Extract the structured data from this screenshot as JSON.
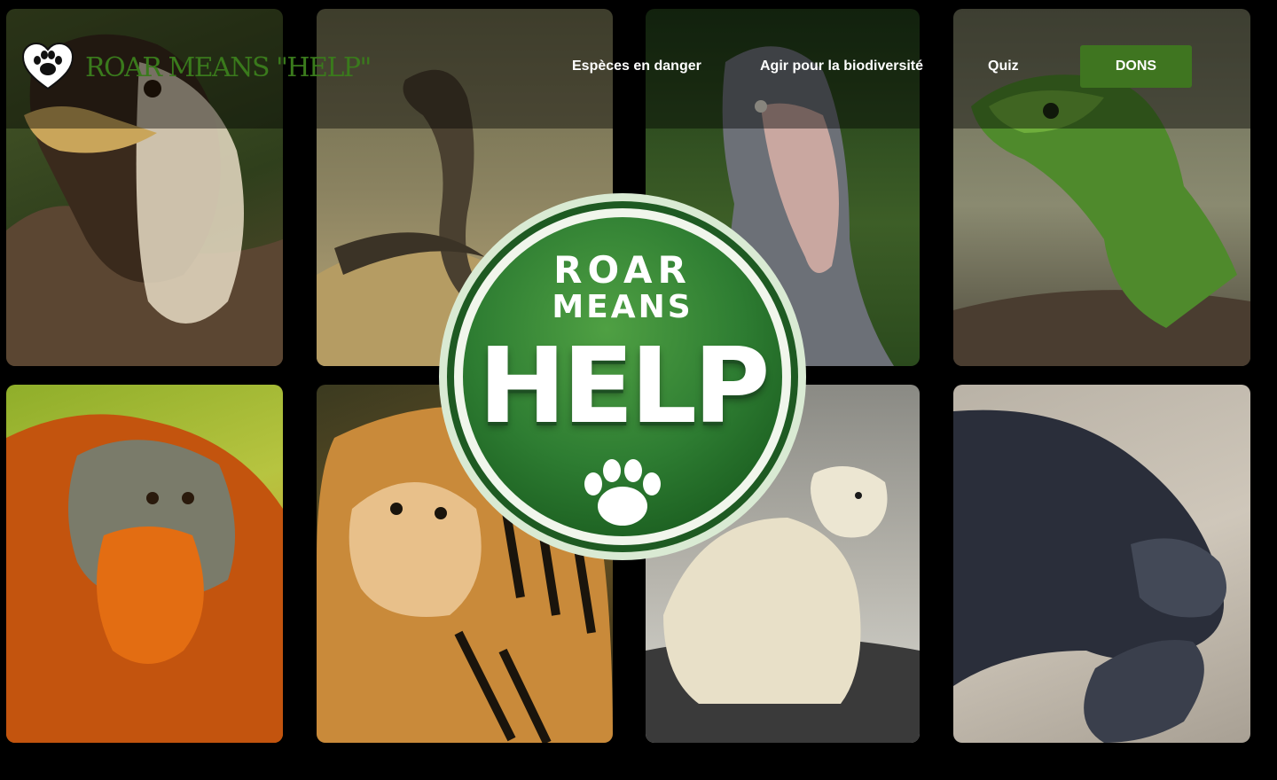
{
  "brand": {
    "name": "ROAR MEANS \"HELP\"",
    "logo_icon": "paw-heart-icon",
    "color": "#3a7a1c"
  },
  "nav": {
    "items": [
      {
        "label": "Espèces en danger"
      },
      {
        "label": "Agir pour la biodiversité"
      },
      {
        "label": "Quiz"
      }
    ],
    "donate_label": "DONS",
    "donate_color": "#3f7520"
  },
  "badge": {
    "line1": "ROAR",
    "line2": "MEANS",
    "line3": "HELP",
    "icon": "paw-icon",
    "color": "#2e7d32"
  },
  "gallery": [
    {
      "animal": "eagle"
    },
    {
      "animal": "king-cobra"
    },
    {
      "animal": "shoebill"
    },
    {
      "animal": "lizard"
    },
    {
      "animal": "orangutan"
    },
    {
      "animal": "tiger"
    },
    {
      "animal": "polar-bear"
    },
    {
      "animal": "leatherback-turtle"
    }
  ]
}
